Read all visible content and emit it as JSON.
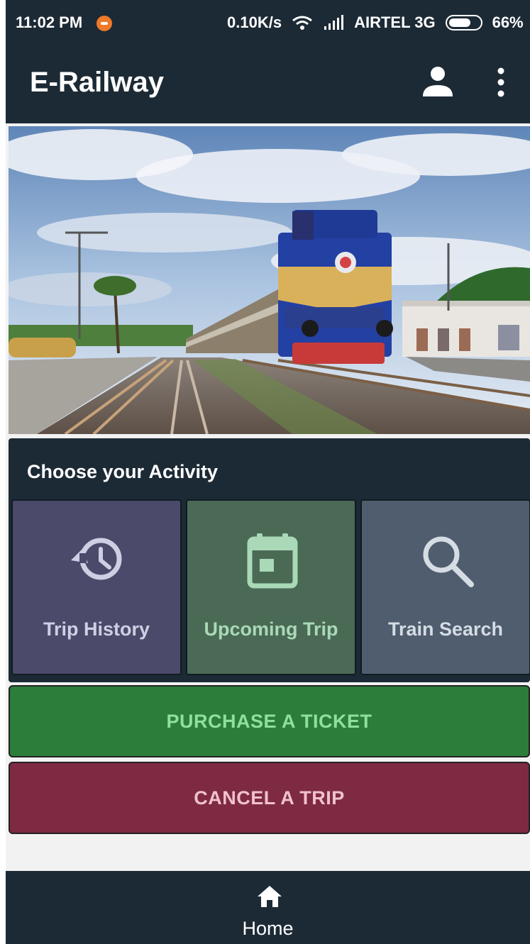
{
  "status_bar": {
    "time": "11:02 PM",
    "speed": "0.10K/s",
    "carrier": "AIRTEL 3G",
    "battery": "66%"
  },
  "app_bar": {
    "title": "E-Railway"
  },
  "activity": {
    "title": "Choose your Activity",
    "tiles": [
      {
        "label": "Trip History",
        "icon": "history-icon",
        "color": "#4b4a6a"
      },
      {
        "label": "Upcoming Trip",
        "icon": "calendar-icon",
        "color": "#4b6a56"
      },
      {
        "label": "Train Search",
        "icon": "search-icon",
        "color": "#4f5d6e"
      }
    ]
  },
  "actions": {
    "purchase_label": "PURCHASE A TICKET",
    "cancel_label": "CANCEL A TRIP"
  },
  "bottom_nav": {
    "home_label": "Home"
  },
  "colors": {
    "primary_dark": "#1c2a35",
    "purchase": "#2d7d3a",
    "cancel": "#7e2a42"
  }
}
